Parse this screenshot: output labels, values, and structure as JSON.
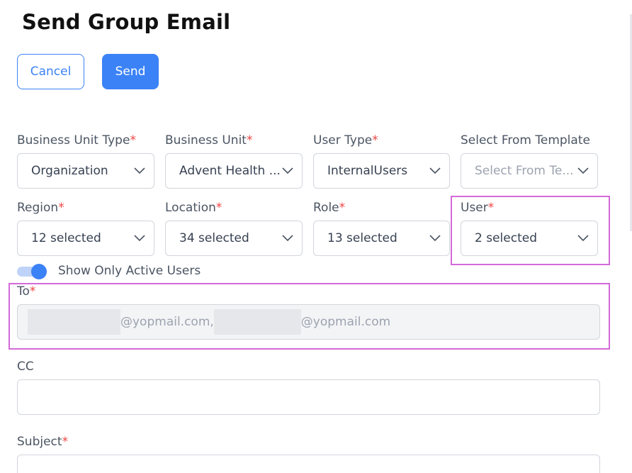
{
  "page": {
    "title": "Send Group Email"
  },
  "actions": {
    "cancel_label": "Cancel",
    "send_label": "Send"
  },
  "form": {
    "business_unit_type": {
      "label": "Business Unit Type",
      "required": "*",
      "value": "Organization"
    },
    "business_unit": {
      "label": "Business Unit",
      "required": "*",
      "value": "Advent Health ..."
    },
    "user_type": {
      "label": "User Type",
      "required": "*",
      "value": "InternalUsers"
    },
    "template": {
      "label": "Select From Template",
      "placeholder": "Select From Te..."
    },
    "region": {
      "label": "Region",
      "required": "*",
      "value": "12 selected"
    },
    "location": {
      "label": "Location",
      "required": "*",
      "value": "34 selected"
    },
    "role": {
      "label": "Role",
      "required": "*",
      "value": "13 selected"
    },
    "user": {
      "label": "User",
      "required": "*",
      "value": "2 selected"
    },
    "active_toggle": {
      "label": "Show Only Active Users",
      "on": true
    },
    "to": {
      "label": "To",
      "required": "*",
      "recipient_1_suffix": "@yopmail.com,",
      "recipient_2_suffix": "@yopmail.com"
    },
    "cc": {
      "label": "CC",
      "value": ""
    },
    "subject": {
      "label": "Subject",
      "required": "*",
      "value": ""
    }
  },
  "icons": {
    "dropdown": "chevron-down-icon"
  },
  "colors": {
    "accent": "#3b82f6",
    "required": "#ef4444",
    "highlight": "#d36ad9"
  }
}
